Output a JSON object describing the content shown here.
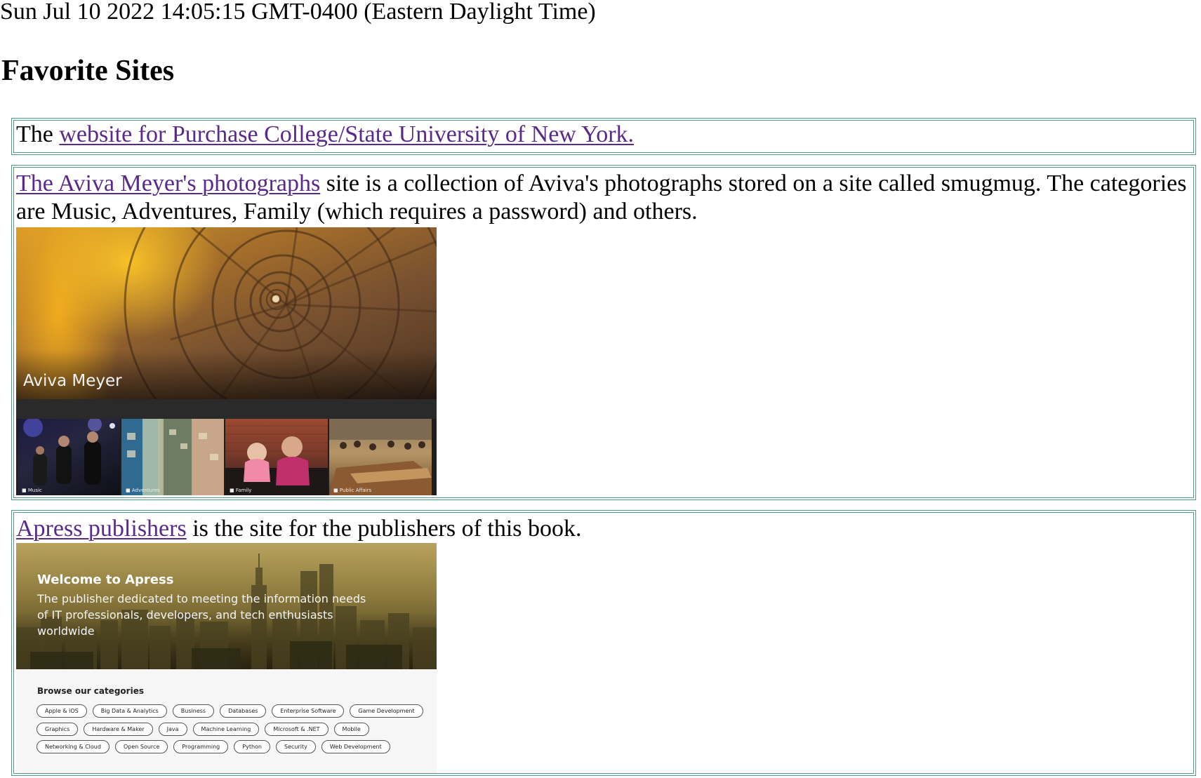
{
  "timestamp": "Sun Jul 10 2022 14:05:15 GMT-0400 (Eastern Daylight Time)",
  "page_title": "Favorite Sites",
  "sites": [
    {
      "prefix": "The ",
      "link_text": "website for Purchase College/State University of New York.",
      "suffix": ""
    },
    {
      "prefix": "",
      "link_text": "The Aviva Meyer's photographs",
      "suffix": " site is a collection of Aviva's photographs stored on a site called smugmug. The categories are Music, Adventures, Family (which requires a password) and others.",
      "screenshot": {
        "hero_label": "Aviva Meyer",
        "galleries": [
          "Music",
          "Adventures",
          "Family",
          "Public Affairs"
        ]
      }
    },
    {
      "prefix": "",
      "link_text": "Apress publishers",
      "suffix": " is the site for the publishers of this book.",
      "screenshot": {
        "heading": "Welcome to Apress",
        "tagline": "The publisher dedicated to meeting the information needs of IT professionals, developers, and tech enthusiasts worldwide",
        "browse_heading": "Browse our categories",
        "category_rows": [
          [
            "Apple & iOS",
            "Big Data & Analytics",
            "Business",
            "Databases",
            "Enterprise Software",
            "Game Development"
          ],
          [
            "Graphics",
            "Hardware & Maker",
            "Java",
            "Machine Learning",
            "Microsoft & .NET",
            "Mobile"
          ],
          [
            "Networking & Cloud",
            "Open Source",
            "Programming",
            "Python",
            "Security",
            "Web Development"
          ]
        ]
      }
    }
  ],
  "colors": {
    "link": "#5a2a8a",
    "box_border": "#4f9a82"
  }
}
